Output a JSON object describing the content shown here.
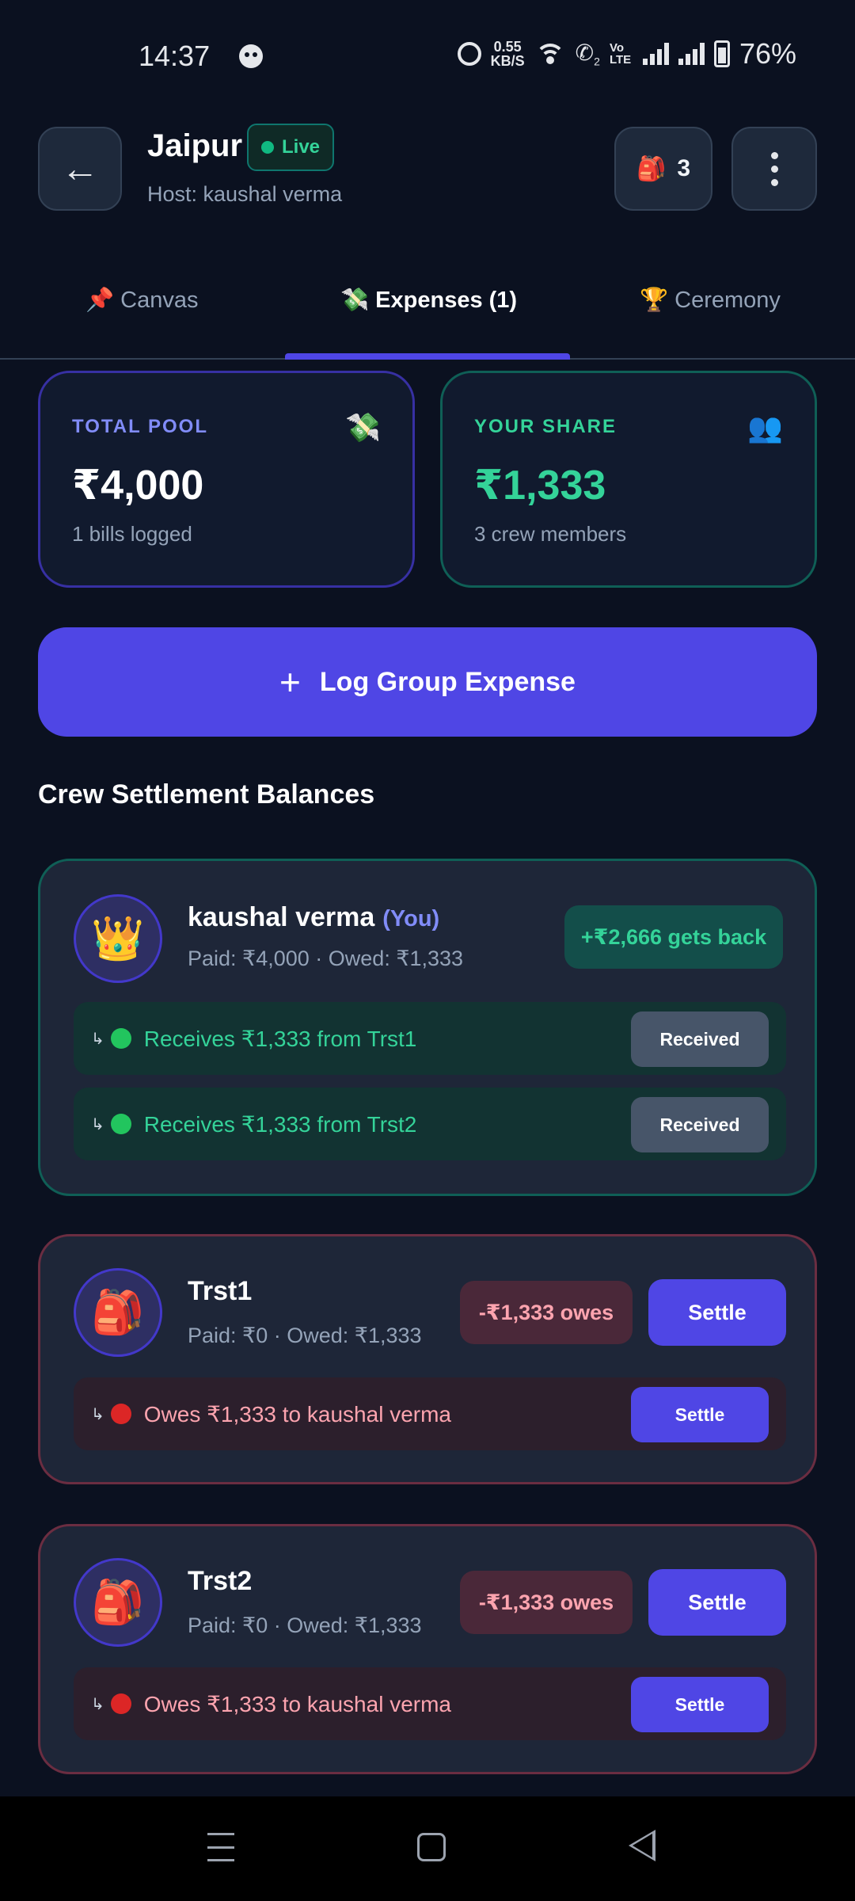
{
  "status_bar": {
    "time": "14:37",
    "speed_value": "0.55",
    "speed_unit": "KB/S",
    "volte": "Vo LTE",
    "sim_label": "2",
    "battery": "76%"
  },
  "header": {
    "title": "Jaipur",
    "live_label": "Live",
    "host": "Host: kaushal verma",
    "crew_count": "3",
    "bag_icon": "🎒"
  },
  "tabs": [
    {
      "label": "📌 Canvas",
      "active": false
    },
    {
      "label": "💸 Expenses (1)",
      "active": true
    },
    {
      "label": "🏆 Ceremony",
      "active": false
    }
  ],
  "stats": {
    "pool": {
      "label": "TOTAL POOL",
      "icon": "💸",
      "value": "₹4,000",
      "sub": "1 bills logged"
    },
    "share": {
      "label": "YOUR SHARE",
      "icon": "👥",
      "value": "₹1,333",
      "sub": "3 crew members"
    }
  },
  "log_button": {
    "plus": "+",
    "label": "Log Group Expense"
  },
  "section_title": "Crew Settlement Balances",
  "members": [
    {
      "avatar": "👑",
      "name": "kaushal verma",
      "you_tag": "(You)",
      "meta": "Paid: ₹4,000 · Owed: ₹1,333",
      "balance": "+₹2,666 gets back",
      "transactions": [
        {
          "arrow": "↳",
          "text": "Receives ₹1,333 from Trst1",
          "action": "Received"
        },
        {
          "arrow": "↳",
          "text": "Receives ₹1,333 from Trst2",
          "action": "Received"
        }
      ]
    },
    {
      "avatar": "🎒",
      "name": "Trst1",
      "meta": "Paid: ₹0 · Owed: ₹1,333",
      "balance": "-₹1,333 owes",
      "settle_label": "Settle",
      "transactions": [
        {
          "arrow": "↳",
          "text": "Owes ₹1,333 to kaushal verma",
          "action": "Settle"
        }
      ]
    },
    {
      "avatar": "🎒",
      "name": "Trst2",
      "meta": "Paid: ₹0 · Owed: ₹1,333",
      "balance": "-₹1,333 owes",
      "settle_label": "Settle",
      "transactions": [
        {
          "arrow": "↳",
          "text": "Owes ₹1,333 to kaushal verma",
          "action": "Settle"
        }
      ]
    }
  ],
  "colors": {
    "background": "#0b1120",
    "accent": "#4f46e5",
    "positive": "#34d399",
    "negative": "#fda4af"
  }
}
